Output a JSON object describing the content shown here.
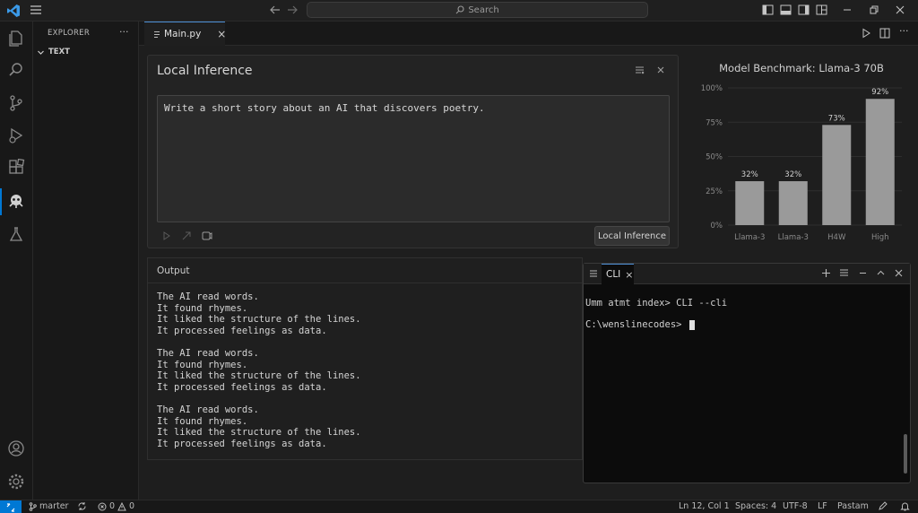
{
  "titlebar": {
    "search_placeholder": "Search"
  },
  "sidebar": {
    "title": "EXPLORER",
    "more": "···",
    "section": "TEXT"
  },
  "tabs": [
    {
      "label": "Main.py",
      "close": "×"
    }
  ],
  "inference": {
    "title": "Local Inference",
    "prompt": "Write a short story about an AI that discovers poetry.",
    "run_label": "Local Inference"
  },
  "output": {
    "title": "Output",
    "text": "The AI read words.\nIt found rhymes.\nIt liked the structure of the lines.\nIt processed feelings as data.\n\nThe AI read words.\nIt found rhymes.\nIt liked the structure of the lines.\nIt processed feelings as data.\n\nThe AI read words.\nIt found rhymes.\nIt liked the structure of the lines.\nIt processed feelings as data."
  },
  "chart_data": {
    "type": "bar",
    "title": "Model Benchmark: Llama-3 70B",
    "categories": [
      "Llama-3",
      "Llama-3",
      "H4W",
      "High"
    ],
    "values": [
      32,
      32,
      73,
      92
    ],
    "value_labels": [
      "32%",
      "32%",
      "73%",
      "92%"
    ],
    "yticks": [
      "0%",
      "25%",
      "50%",
      "75%",
      "100%"
    ],
    "ylim": [
      0,
      100
    ],
    "bar_color": "#9a9a9a"
  },
  "terminal": {
    "tab_label": "CLI",
    "tab_close": "×",
    "lines": [
      "Umm atmt index> CLI --cli",
      "C:\\wenslinecodes> "
    ]
  },
  "statusbar": {
    "branch": "marter",
    "errors": "0",
    "warnings": "0",
    "position": "Ln 12, Col 1",
    "spaces": "Spaces: 4",
    "encoding": "UTF-8",
    "eol": "LF",
    "language": "Pastam"
  },
  "colors": {
    "accent": "#0078d4",
    "tab_border": "#4d8fd6"
  }
}
